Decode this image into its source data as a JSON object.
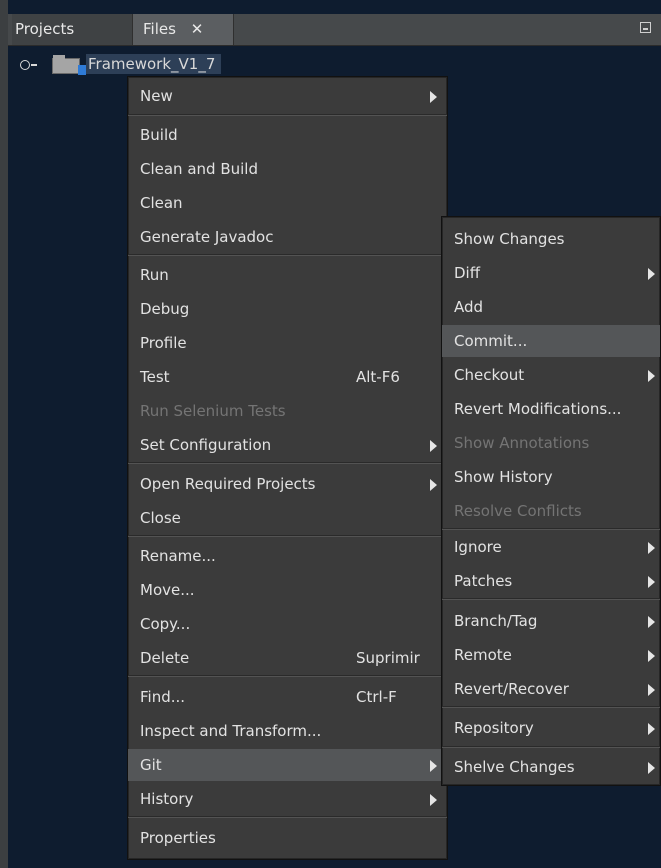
{
  "tabs": [
    {
      "label": "Projects"
    },
    {
      "label": "Files",
      "close": "✕"
    }
  ],
  "tree": {
    "project": "Framework_V1_7"
  },
  "main_menu": {
    "items": [
      {
        "label": "New"
      },
      {
        "label": "Build"
      },
      {
        "label": "Clean and Build"
      },
      {
        "label": "Clean"
      },
      {
        "label": "Generate Javadoc"
      },
      {
        "label": "Run"
      },
      {
        "label": "Debug"
      },
      {
        "label": "Profile"
      },
      {
        "label": "Test",
        "shortcut": "Alt-F6"
      },
      {
        "label": "Run Selenium Tests"
      },
      {
        "label": "Set Configuration"
      },
      {
        "label": "Open Required Projects"
      },
      {
        "label": "Close"
      },
      {
        "label": "Rename..."
      },
      {
        "label": "Move..."
      },
      {
        "label": "Copy..."
      },
      {
        "label": "Delete",
        "shortcut": "Suprimir"
      },
      {
        "label": "Find...",
        "shortcut": "Ctrl-F"
      },
      {
        "label": "Inspect and Transform..."
      },
      {
        "label": "Git"
      },
      {
        "label": "History"
      },
      {
        "label": "Properties"
      }
    ]
  },
  "git_menu": {
    "items": [
      {
        "label": "Show Changes"
      },
      {
        "label": "Diff"
      },
      {
        "label": "Add"
      },
      {
        "label": "Commit..."
      },
      {
        "label": "Checkout"
      },
      {
        "label": "Revert Modifications..."
      },
      {
        "label": "Show Annotations"
      },
      {
        "label": "Show History"
      },
      {
        "label": "Resolve Conflicts"
      },
      {
        "label": "Ignore"
      },
      {
        "label": "Patches"
      },
      {
        "label": "Branch/Tag"
      },
      {
        "label": "Remote"
      },
      {
        "label": "Revert/Recover"
      },
      {
        "label": "Repository"
      },
      {
        "label": "Shelve Changes"
      }
    ]
  },
  "colors": {
    "panel_background": "#0d1b2e",
    "menu_background": "#3b3b3b",
    "selected_item": "#545658",
    "disabled_text": "#747474"
  },
  "icons": {
    "expand": "expand-icon",
    "folder": "folder-icon",
    "project_badge": "project-badge-icon",
    "submenu_arrow": "chevron-right-icon",
    "minimize": "minimize-icon",
    "close_tab": "close-icon"
  }
}
